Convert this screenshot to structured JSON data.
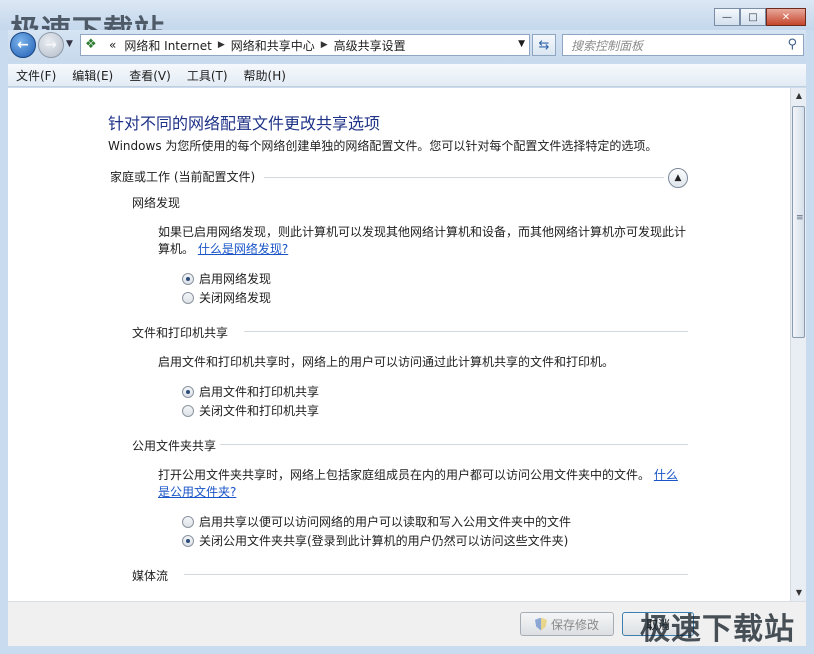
{
  "window": {
    "minimize": "—",
    "maximize": "□",
    "close": "✕"
  },
  "watermark": {
    "text": "极速下载站"
  },
  "nav": {
    "back_icon": "back-arrow-icon",
    "forward_icon": "forward-arrow-icon",
    "breadcrumb_prefix": "«",
    "breadcrumb": [
      "网络和 Internet",
      "网络和共享中心",
      "高级共享设置"
    ],
    "search_placeholder": "搜索控制面板"
  },
  "menu": [
    "文件(F)",
    "编辑(E)",
    "查看(V)",
    "工具(T)",
    "帮助(H)"
  ],
  "content": {
    "title": "针对不同的网络配置文件更改共享选项",
    "description": "Windows 为您所使用的每个网络创建单独的网络配置文件。您可以针对每个配置文件选择特定的选项。",
    "group_header": "家庭或工作 (当前配置文件)",
    "sections": [
      {
        "title": "网络发现",
        "text": "如果已启用网络发现，则此计算机可以发现其他网络计算机和设备，而其他网络计算机亦可发现此计算机。",
        "link": "什么是网络发现?",
        "options": [
          {
            "label": "启用网络发现",
            "selected": true
          },
          {
            "label": "关闭网络发现",
            "selected": false
          }
        ]
      },
      {
        "title": "文件和打印机共享",
        "text": "启用文件和打印机共享时，网络上的用户可以访问通过此计算机共享的文件和打印机。",
        "options": [
          {
            "label": "启用文件和打印机共享",
            "selected": true
          },
          {
            "label": "关闭文件和打印机共享",
            "selected": false
          }
        ]
      },
      {
        "title": "公用文件夹共享",
        "text": "打开公用文件夹共享时，网络上包括家庭组成员在内的用户都可以访问公用文件夹中的文件。",
        "link": "什么是公用文件夹?",
        "options": [
          {
            "label": "启用共享以便可以访问网络的用户可以读取和写入公用文件夹中的文件",
            "selected": false
          },
          {
            "label": "关闭公用文件夹共享(登录到此计算机的用户仍然可以访问这些文件夹)",
            "selected": true
          }
        ]
      },
      {
        "title": "媒体流"
      }
    ]
  },
  "footer": {
    "save_label": "保存修改",
    "cancel_label": "取消"
  }
}
